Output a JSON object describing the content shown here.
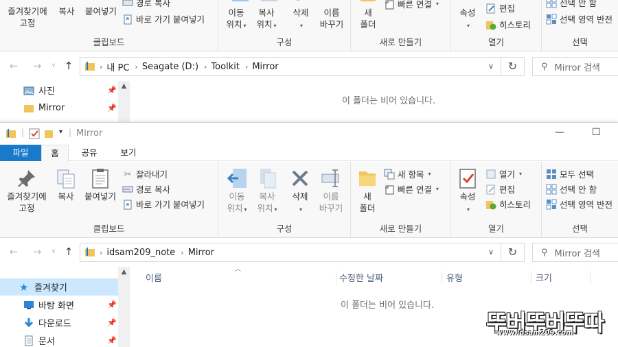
{
  "back_window": {
    "ribbon": {
      "clipboard": {
        "pin_l1": "즐겨찾기에",
        "pin_l2": "고정",
        "copy": "복사",
        "paste": "붙여넣기",
        "copy_path": "경로 복사",
        "paste_shortcut": "바로 가기 붙여넣기",
        "label": "클립보드"
      },
      "organize": {
        "move_l1": "이동",
        "move_l2": "위치",
        "copy_l1": "복사",
        "copy_l2": "위치",
        "delete": "삭제",
        "rename_l1": "이름",
        "rename_l2": "바꾸기",
        "label": "구성"
      },
      "new": {
        "new_l1": "새",
        "new_l2": "폴더",
        "easy_access": "빠른 연결",
        "label": "새로 만들기"
      },
      "open": {
        "properties": "속성",
        "edit": "편집",
        "history": "히스토리",
        "label": "열기"
      },
      "select": {
        "select_none": "선택 안 함",
        "invert": "선택 영역 반전",
        "label": "선택"
      }
    },
    "address": {
      "crumbs": [
        "내 PC",
        "Seagate (D:)",
        "Toolkit",
        "Mirror"
      ]
    },
    "search_placeholder": "Mirror 검색",
    "nav": [
      {
        "label": "사진"
      },
      {
        "label": "Mirror"
      }
    ],
    "empty_message": "이 폴더는 비어 있습니다."
  },
  "front_window": {
    "title": "Mirror",
    "tabs": {
      "file": "파일",
      "home": "홈",
      "share": "공유",
      "view": "보기"
    },
    "ribbon": {
      "clipboard": {
        "pin_l1": "즐겨찾기에",
        "pin_l2": "고정",
        "copy": "복사",
        "paste": "붙여넣기",
        "cut": "잘라내기",
        "copy_path": "경로 복사",
        "paste_shortcut": "바로 가기 붙여넣기",
        "label": "클립보드"
      },
      "organize": {
        "move_l1": "이동",
        "move_l2": "위치",
        "copy_l1": "복사",
        "copy_l2": "위치",
        "delete": "삭제",
        "rename_l1": "이름",
        "rename_l2": "바꾸기",
        "label": "구성"
      },
      "new": {
        "new_l1": "새",
        "new_l2": "폴더",
        "new_item": "새 항목",
        "easy_access": "빠른 연결",
        "label": "새로 만들기"
      },
      "open": {
        "properties": "속성",
        "open": "열기",
        "edit": "편집",
        "history": "히스토리",
        "label": "열기"
      },
      "select": {
        "select_all": "모두 선택",
        "select_none": "선택 안 함",
        "invert": "선택 영역 반전",
        "label": "선택"
      }
    },
    "address": {
      "crumbs": [
        "idsam209_note",
        "Mirror"
      ]
    },
    "search_placeholder": "Mirror 검색",
    "columns": [
      "이름",
      "수정한 날짜",
      "유형",
      "크기"
    ],
    "nav": [
      {
        "label": "즐겨찾기"
      },
      {
        "label": "바탕 화면"
      },
      {
        "label": "다운로드"
      },
      {
        "label": "문서"
      }
    ],
    "empty_message": "이 폴더는 비어 있습니다."
  },
  "watermark": {
    "logo": "뚜버뚜버뚜따",
    "url": "www.idsam209.com"
  },
  "colors": {
    "file_tab": "#1979ca",
    "nav_selected": "#cce8ff",
    "accent_blue": "#1979ca"
  }
}
